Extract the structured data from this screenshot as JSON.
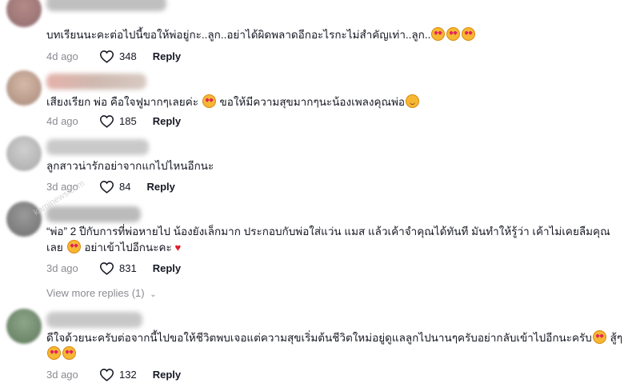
{
  "comments": [
    {
      "text_before": "บทเรียนนะคะต่อไปนี้ขอให้พ่อยู่กะ..ลูก..อย่าได้ผิดพลาดอีกอะไรกะไม่สำคัญเท่า..ลูก..",
      "emoji_after": [
        "heart-face",
        "heart-face",
        "heart-face"
      ],
      "time": "4d ago",
      "likes": "348",
      "reply_label": "Reply"
    },
    {
      "text_before": "เสียงเรียก พ่อ คือใจฟูมากๆเลยค่ะ ",
      "text_after": " ขอให้มีความสุขมากๆนะน้องเพลงคุณพ่อ",
      "time": "4d ago",
      "likes": "185",
      "reply_label": "Reply"
    },
    {
      "text_before": "ลูกสาวน่ารักอย่าจากแกไปไหนอีกนะ",
      "time": "3d ago",
      "likes": "84",
      "reply_label": "Reply"
    },
    {
      "text_before": "“พ่อ” 2 ปีกับการที่พ่อหายไป น้องยังเล็กมาก ประกอบกับพ่อใส่แว่น แมส แล้วเค้าจำคุณได้ทันที มันทำให้รู้ว่า เค้าไม่เคยลืมคุณ",
      "line2_before": "เลย ",
      "line2_after": " อย่าเข้าไปอีกนะคะ ",
      "time": "3d ago",
      "likes": "831",
      "reply_label": "Reply",
      "view_more": "View more replies (1)"
    },
    {
      "text_before": "ดีใจด้วยนะครับต่อจากนี้ไปขอให้ชีวิตพบเจอแต่ความสุขเริ่มต้นชีวิตใหม่อยู่ดูแลลูกไปนานๆครับอย่ากลับเข้าไปอีกนะครับ",
      "text_after": " สู้ๆ",
      "time": "3d ago",
      "likes": "132",
      "reply_label": "Reply"
    }
  ],
  "watermark": "kaminews.com",
  "icons": {
    "like": "heart-outline-icon",
    "chevron": "chevron-down-icon"
  },
  "colors": {
    "muted": "#8a8b91",
    "text": "#161823",
    "heart": "#e01a2b"
  }
}
